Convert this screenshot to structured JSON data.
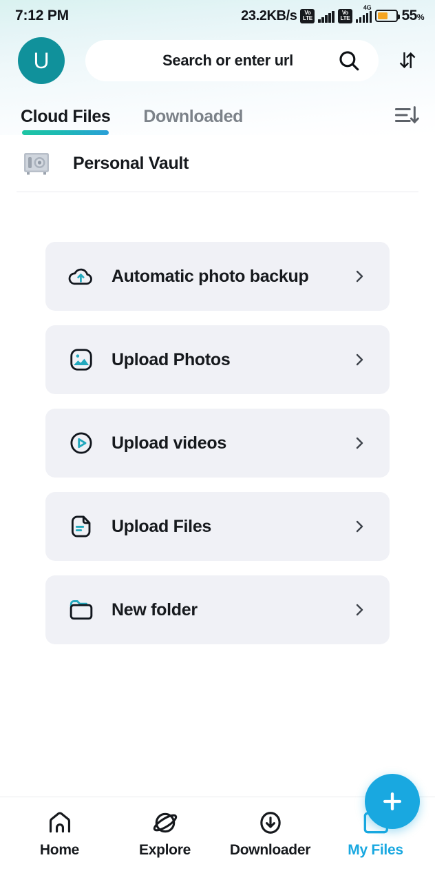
{
  "status_bar": {
    "time": "7:12 PM",
    "net_speed": "23.2KB/s",
    "volte_top": "Vo",
    "volte_bottom": "LTE",
    "network_gen": "4G",
    "battery_percent": "55",
    "battery_unit": "%",
    "battery_level": 55
  },
  "header": {
    "avatar_initial": "U",
    "search_placeholder": "Search or enter url"
  },
  "tabs": [
    {
      "label": "Cloud Files",
      "active": true
    },
    {
      "label": "Downloaded",
      "active": false
    }
  ],
  "vault": {
    "label": "Personal Vault"
  },
  "actions": [
    {
      "label": "Automatic photo backup",
      "icon": "cloud-upload-icon"
    },
    {
      "label": "Upload Photos",
      "icon": "image-icon"
    },
    {
      "label": "Upload videos",
      "icon": "play-circle-icon"
    },
    {
      "label": "Upload Files",
      "icon": "document-icon"
    },
    {
      "label": "New folder",
      "icon": "folder-icon"
    }
  ],
  "fab": {
    "label": "+"
  },
  "bottom_nav": [
    {
      "label": "Home",
      "icon": "home-icon",
      "active": false
    },
    {
      "label": "Explore",
      "icon": "planet-icon",
      "active": false
    },
    {
      "label": "Downloader",
      "icon": "download-circle-icon",
      "active": false
    },
    {
      "label": "My Files",
      "icon": "folder-icon",
      "active": true
    }
  ],
  "colors": {
    "accent": "#19a8e0",
    "avatar": "#10919b",
    "icon_teal": "#23a8bd",
    "card_bg": "#f0f1f6",
    "tab_gradient_start": "#1dc5a3",
    "tab_gradient_end": "#2a9fd8",
    "battery_fill": "#f5a623"
  }
}
